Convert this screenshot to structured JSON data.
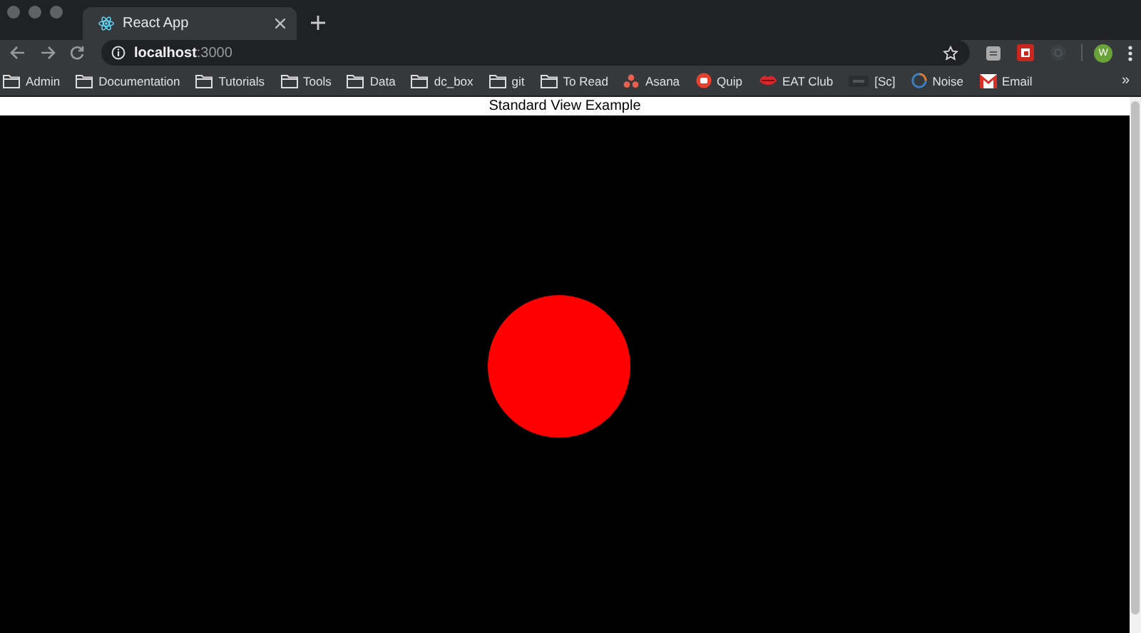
{
  "tabs": [
    {
      "title": "React App",
      "selected": true
    }
  ],
  "address": {
    "host": "localhost",
    "port": ":3000"
  },
  "profile": {
    "initial": "W"
  },
  "bookmarks": [
    {
      "label": "Admin",
      "kind": "folder"
    },
    {
      "label": "Documentation",
      "kind": "folder"
    },
    {
      "label": "Tutorials",
      "kind": "folder"
    },
    {
      "label": "Tools",
      "kind": "folder"
    },
    {
      "label": "Data",
      "kind": "folder"
    },
    {
      "label": "dc_box",
      "kind": "folder"
    },
    {
      "label": "git",
      "kind": "folder"
    },
    {
      "label": "To Read",
      "kind": "folder"
    },
    {
      "label": "Asana",
      "kind": "dots"
    },
    {
      "label": "Quip",
      "kind": "quip"
    },
    {
      "label": "EAT Club",
      "kind": "lips"
    },
    {
      "label": "[Sc]",
      "kind": "sc"
    },
    {
      "label": "Noise",
      "kind": "ring"
    },
    {
      "label": "Email",
      "kind": "mail"
    }
  ],
  "bookmarks_overflow": "»",
  "page": {
    "heading": "Standard View Example"
  }
}
